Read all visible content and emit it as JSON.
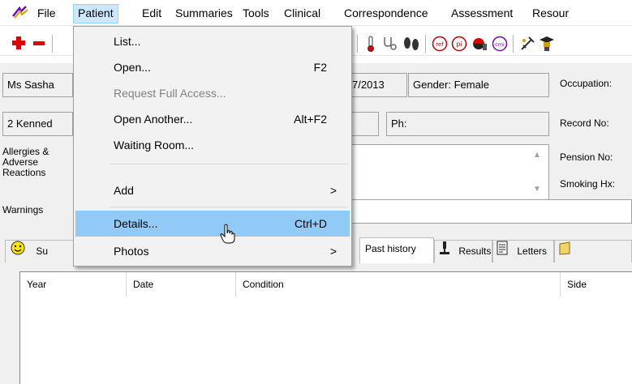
{
  "menubar": {
    "items": [
      "File",
      "Patient",
      "Edit",
      "Summaries",
      "Tools",
      "Clinical",
      "Correspondence",
      "Assessment",
      "Resour"
    ]
  },
  "patient_menu": {
    "items": [
      {
        "label": "List...",
        "shortcut": ""
      },
      {
        "label": "Open...",
        "shortcut": "F2"
      },
      {
        "label": "Request Full Access...",
        "shortcut": ""
      },
      {
        "label": "Open Another...",
        "shortcut": "Alt+F2"
      },
      {
        "label": "Waiting Room...",
        "shortcut": ""
      },
      {
        "label": "Add",
        "shortcut": "",
        "arrow": ">"
      },
      {
        "label": "Details...",
        "shortcut": "Ctrl+D"
      },
      {
        "label": "Photos",
        "shortcut": "",
        "arrow": ">"
      }
    ]
  },
  "patient": {
    "name": "Ms Sasha",
    "dob_fragment": "7/2013",
    "gender": "Gender: Female",
    "occupation_label": "Occupation:",
    "address": "2 Kenned",
    "phone_label": "Ph:",
    "record_label": "Record No:",
    "allergies_label_1": "Allergies &",
    "allergies_label_2": "Adverse",
    "allergies_label_3": "Reactions",
    "pension_label": "Pension No:",
    "smoking_label": "Smoking Hx:",
    "warnings_label": "Warnings"
  },
  "tabs": {
    "summary_fragment": "Su",
    "past_history": "Past history",
    "results": "Results",
    "letters": "Letters"
  },
  "grid": {
    "columns": [
      "Year",
      "Date",
      "Condition",
      "Side"
    ]
  },
  "colors": {
    "menu_highlight": "#91c9f7",
    "menubar_active": "#cce8ff"
  }
}
